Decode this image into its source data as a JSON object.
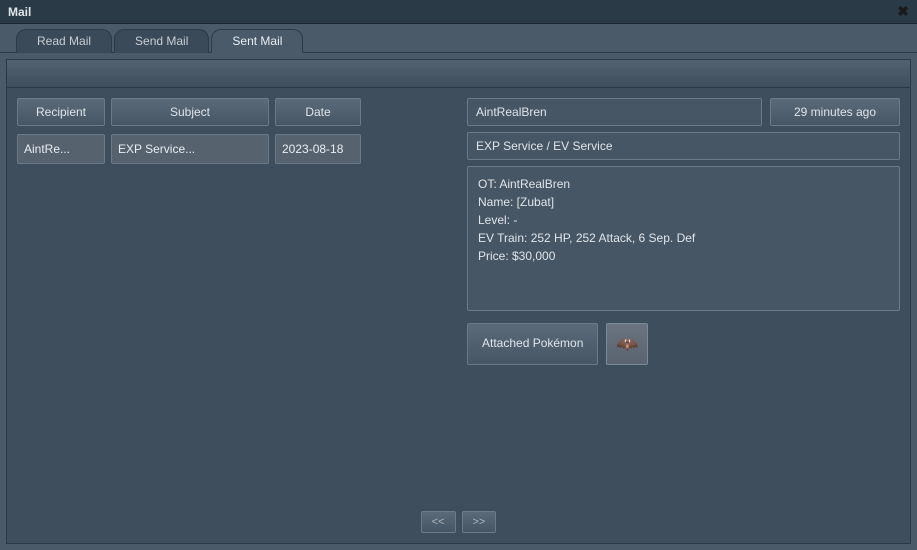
{
  "window": {
    "title": "Mail",
    "close_icon": "✖"
  },
  "tabs": [
    {
      "label": "Read Mail",
      "active": false
    },
    {
      "label": "Send Mail",
      "active": false
    },
    {
      "label": "Sent Mail",
      "active": true
    }
  ],
  "columns": {
    "recipient": "Recipient",
    "subject": "Subject",
    "date": "Date"
  },
  "mail_rows": [
    {
      "recipient": "AintRe...",
      "subject": "EXP Service...",
      "date": "2023-08-18"
    }
  ],
  "detail": {
    "from": "AintRealBren",
    "time_ago": "29 minutes  ago",
    "subject": "EXP Service / EV Service",
    "body": "OT: AintRealBren\nName: [Zubat]\nLevel: -\nEV Train: 252 HP, 252 Attack, 6 Sep. Def\nPrice: $30,000",
    "attachment_label": "Attached Pokémon",
    "attachment_sprite": "🦇"
  },
  "pagination": {
    "prev": "<<",
    "next": ">>"
  }
}
